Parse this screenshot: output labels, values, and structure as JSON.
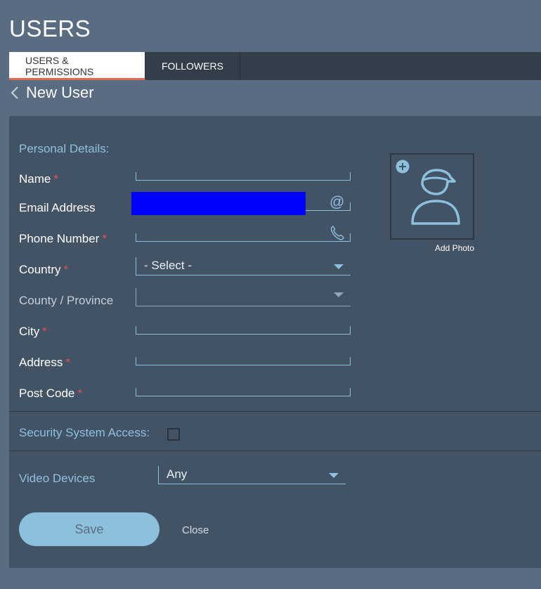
{
  "page": {
    "title": "USERS"
  },
  "tabs": [
    {
      "label": "USERS & PERMISSIONS",
      "active": true
    },
    {
      "label": "FOLLOWERS",
      "active": false
    }
  ],
  "subheader": {
    "title": "New User",
    "back_icon": "chevron-left-icon"
  },
  "form": {
    "section_personal": "Personal Details:",
    "fields": {
      "name": {
        "label": "Name",
        "required": "*",
        "value": ""
      },
      "email": {
        "label": "Email Address",
        "icon": "@",
        "value": ""
      },
      "phone": {
        "label": "Phone Number",
        "required": "*",
        "icon": "phone-icon",
        "value": ""
      },
      "country": {
        "label": "Country",
        "required": "*",
        "selected": "- Select -"
      },
      "county": {
        "label": "County / Province",
        "selected": ""
      },
      "city": {
        "label": "City",
        "required": "*",
        "value": ""
      },
      "address": {
        "label": "Address",
        "required": "*",
        "value": ""
      },
      "postcode": {
        "label": "Post Code",
        "required": "*",
        "value": ""
      }
    },
    "photo": {
      "caption": "Add Photo",
      "icon": "user-avatar-icon",
      "add_icon": "plus-icon"
    },
    "security": {
      "label": "Security System Access:",
      "checked": false
    },
    "video": {
      "label": "Video Devices",
      "selected": "Any"
    },
    "actions": {
      "save_label": "Save",
      "close_label": "Close"
    }
  },
  "colors": {
    "background": "#5a6c82",
    "panel": "#435366",
    "tabbar": "#343e4b",
    "accent": "#8dc0dd",
    "active_tab_underline": "#e06a4f",
    "required": "#e25050"
  }
}
